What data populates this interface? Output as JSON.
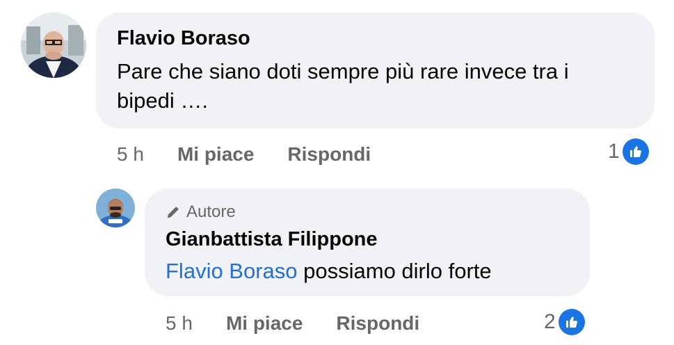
{
  "comment": {
    "author": "Flavio Boraso",
    "text": "Pare che siano doti sempre più rare invece tra i bipedi ….",
    "time": "5 h",
    "like_label": "Mi piace",
    "reply_label": "Rispondi",
    "reaction_count": "1"
  },
  "reply": {
    "badge": "Autore",
    "author": "Gianbattista Filippone",
    "mention": "Flavio Boraso",
    "text": " possiamo dirlo forte",
    "time": "5 h",
    "like_label": "Mi piace",
    "reply_label": "Rispondi",
    "reaction_count": "2"
  },
  "colors": {
    "bubble": "#f0f2f5",
    "mention": "#216fdb",
    "like_badge": "#1b74e4",
    "secondary_text": "#65676b"
  }
}
